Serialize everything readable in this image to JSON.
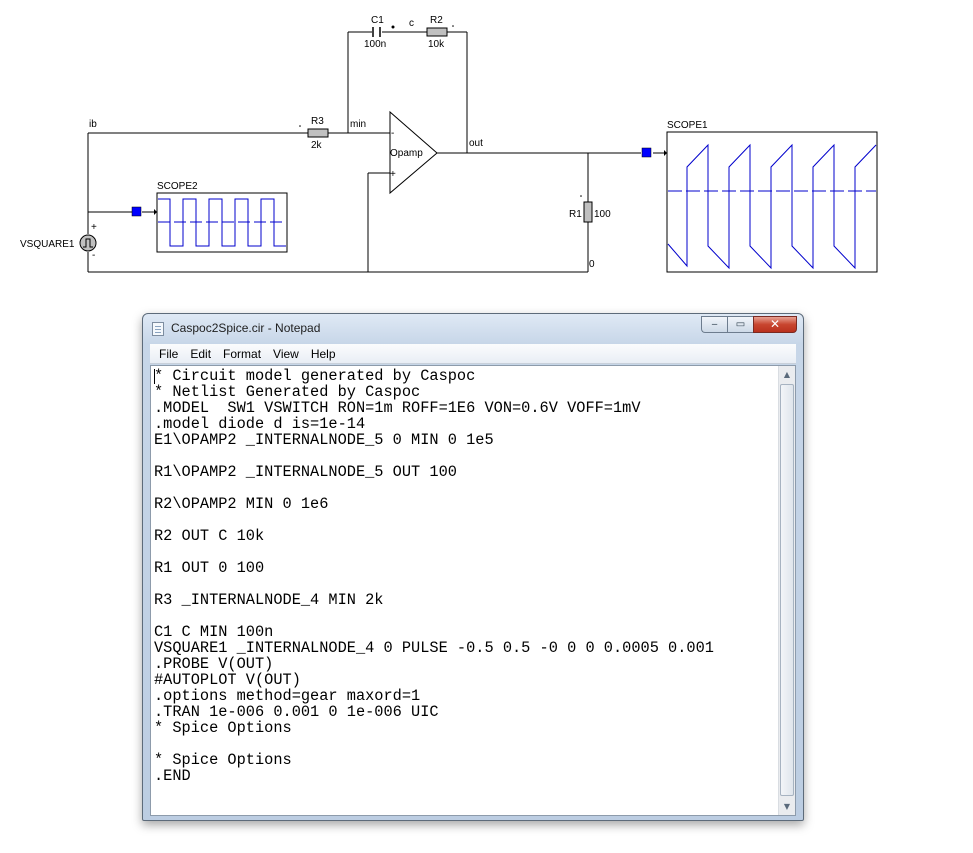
{
  "schematic": {
    "labels": {
      "ib": "ib",
      "c1_name": "C1",
      "c1_value": "100n",
      "node_c": "c",
      "r2_name": "R2",
      "r2_value": "10k",
      "r3_name": "R3",
      "r3_value": "2k",
      "node_min": "min",
      "opamp_name": "Opamp",
      "opamp_minus": "-",
      "opamp_plus": "+",
      "node_out": "out",
      "scope1_name": "SCOPE1",
      "scope2_name": "SCOPE2",
      "r1_name": "R1",
      "r1_value": "100",
      "source_name": "VSQUARE1",
      "source_plus": "+",
      "source_minus": "-",
      "ground_node": "0"
    },
    "colors": {
      "wire": "#000000",
      "trace": "#0000cc",
      "probe": "#0000ff",
      "component_fill": "#c0c0c0"
    }
  },
  "notepad": {
    "title": "Caspoc2Spice.cir - Notepad",
    "icon": "notepad-icon",
    "window_buttons": {
      "minimize": "‒",
      "maximize": "▭",
      "close": "✕"
    },
    "menu": [
      "File",
      "Edit",
      "Format",
      "View",
      "Help"
    ],
    "content": "* Circuit model generated by Caspoc\n* Netlist Generated by Caspoc\n.MODEL  SW1 VSWITCH RON=1m ROFF=1E6 VON=0.6V VOFF=1mV\n.model diode d is=1e-14\nE1\\OPAMP2 _INTERNALNODE_5 0 MIN 0 1e5\n\nR1\\OPAMP2 _INTERNALNODE_5 OUT 100\n\nR2\\OPAMP2 MIN 0 1e6\n\nR2 OUT C 10k\n\nR1 OUT 0 100\n\nR3 _INTERNALNODE_4 MIN 2k\n\nC1 C MIN 100n\nVSQUARE1 _INTERNALNODE_4 0 PULSE -0.5 0.5 -0 0 0 0.0005 0.001\n.PROBE V(OUT)\n#AUTOPLOT V(OUT)\n.options method=gear maxord=1\n.TRAN 1e-006 0.001 0 1e-006 UIC\n* Spice Options\n\n* Spice Options\n.END"
  }
}
